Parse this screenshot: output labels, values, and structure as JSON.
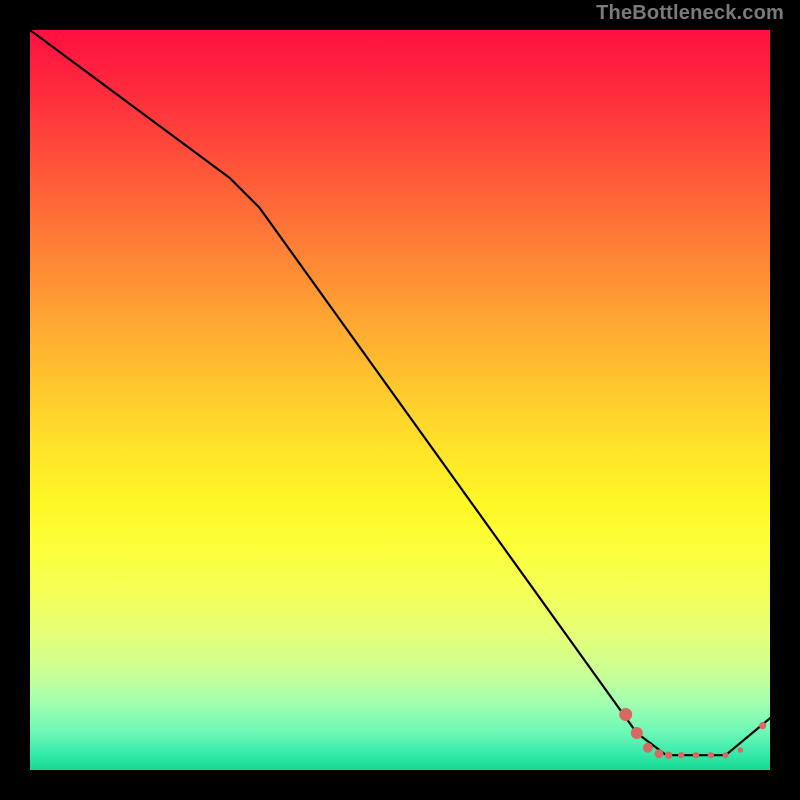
{
  "watermark": "TheBottleneck.com",
  "chart_data": {
    "type": "line",
    "title": "",
    "xlabel": "",
    "ylabel": "",
    "xlim": [
      0,
      100
    ],
    "ylim": [
      0,
      100
    ],
    "series": [
      {
        "name": "curve",
        "color": "#000000",
        "points": [
          {
            "x": 0,
            "y": 100
          },
          {
            "x": 27,
            "y": 80
          },
          {
            "x": 31,
            "y": 76
          },
          {
            "x": 82,
            "y": 5
          },
          {
            "x": 86,
            "y": 2
          },
          {
            "x": 94,
            "y": 2
          },
          {
            "x": 100,
            "y": 7
          }
        ]
      }
    ],
    "markers": [
      {
        "x": 80.5,
        "y": 7.5,
        "r": 6.5
      },
      {
        "x": 82.0,
        "y": 5.0,
        "r": 6.0
      },
      {
        "x": 83.5,
        "y": 3.0,
        "r": 5.0
      },
      {
        "x": 85.0,
        "y": 2.2,
        "r": 4.5
      },
      {
        "x": 86.3,
        "y": 2.0,
        "r": 3.7
      },
      {
        "x": 88.0,
        "y": 2.0,
        "r": 3.2
      },
      {
        "x": 90.0,
        "y": 2.0,
        "r": 3.2
      },
      {
        "x": 92.0,
        "y": 2.0,
        "r": 3.2
      },
      {
        "x": 94.0,
        "y": 2.0,
        "r": 3.0
      },
      {
        "x": 96.0,
        "y": 2.7,
        "r": 2.8
      },
      {
        "x": 99.0,
        "y": 6.0,
        "r": 3.6
      }
    ],
    "marker_color": "#d66a63"
  }
}
